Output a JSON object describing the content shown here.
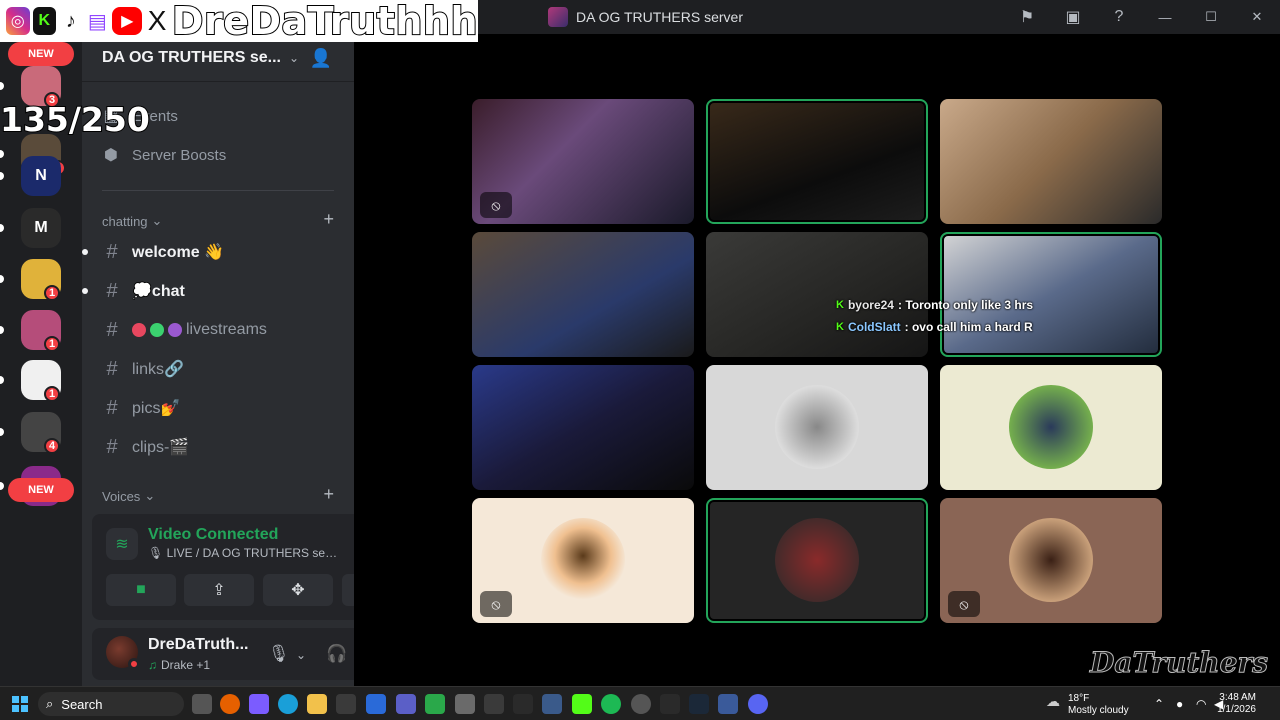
{
  "social_overlay": {
    "icons": [
      "instagram-icon",
      "kick-icon",
      "tiktok-icon",
      "twitch-icon",
      "youtube-icon",
      "x-icon"
    ],
    "handle": "DreDaTruthhh",
    "counter": "135/250"
  },
  "titlebar": {
    "title": "DA OG TRUTHERS server",
    "buttons": [
      "flag-icon",
      "inbox-icon",
      "help-icon",
      "minimize-icon",
      "maximize-icon",
      "close-icon"
    ]
  },
  "server_rail": {
    "new_top": "NEW",
    "new_bottom": "NEW",
    "servers": [
      {
        "name": "server-1",
        "badge": "3",
        "color": "#c96a7a"
      },
      {
        "name": "server-2",
        "badge": "20",
        "color": "#5a4b3a"
      },
      {
        "name": "server-3",
        "badge": "",
        "color": "#1b2a6b",
        "letter": "N"
      },
      {
        "name": "server-4",
        "badge": "",
        "color": "#2a2a2a",
        "letter": "M"
      },
      {
        "name": "server-5",
        "badge": "1",
        "color": "#e0b23a"
      },
      {
        "name": "server-6",
        "badge": "1",
        "color": "#b54d7a"
      },
      {
        "name": "server-7",
        "badge": "1",
        "color": "#f0f0f0"
      },
      {
        "name": "server-8",
        "badge": "4",
        "color": "#444"
      },
      {
        "name": "server-9",
        "badge": "",
        "color": "#8a2a8a"
      }
    ]
  },
  "sidebar": {
    "server_name": "DA OG TRUTHERS se...",
    "events_label": "Events",
    "boosts_label": "Server Boosts",
    "chatting_label": "chatting",
    "voices_label": "Voices",
    "channels": [
      {
        "name": "welcome 👋",
        "unread": true
      },
      {
        "name": "💭chat",
        "unread": true
      },
      {
        "name": "livestreams",
        "unread": false,
        "dots": [
          "#e8475f",
          "#3bd16f",
          "#9b59d0"
        ]
      },
      {
        "name": "links🔗",
        "unread": false
      },
      {
        "name": "pics💅",
        "unread": false
      },
      {
        "name": "clips-🎬",
        "unread": false
      }
    ]
  },
  "voice_panel": {
    "title": "Video Connected",
    "subtitle": "🎙 LIVE / DA OG TRUTHERS ser...",
    "buttons": [
      "camera-button",
      "screenshare-button",
      "activities-button",
      "soundboard-button"
    ]
  },
  "user_panel": {
    "name": "DreDaTruth...",
    "status": "Drake +1"
  },
  "stage": {
    "tiles": [
      {
        "name": "participant-1",
        "bg": "linear-gradient(135deg,#3a1d2a,#6a4a7a 40%,#1a1a2a)",
        "speaking": false,
        "muted": true
      },
      {
        "name": "participant-2",
        "bg": "linear-gradient(160deg,#3a2a1a,#0c0c0c 60%,#1e1e1e)",
        "speaking": true,
        "muted": false
      },
      {
        "name": "participant-3",
        "bg": "linear-gradient(135deg,#c9a98a,#8a6a4a 50%,#2a2a2a)",
        "speaking": false,
        "muted": false
      },
      {
        "name": "participant-4",
        "bg": "linear-gradient(150deg,#5a4a3a,#2a3a6a 60%,#1a1a1a)",
        "speaking": false,
        "muted": false
      },
      {
        "name": "participant-5",
        "bg": "linear-gradient(150deg,#3a3a38,#252523 60%,#151515)",
        "speaking": false,
        "muted": false
      },
      {
        "name": "participant-6",
        "bg": "linear-gradient(150deg,#d8d8d8,#5a6a8a 50%,#202a3a)",
        "speaking": true,
        "muted": false
      },
      {
        "name": "participant-7",
        "bg": "linear-gradient(150deg,#2a3a8a,#1a1a3a 50%,#0a0a0a)",
        "speaking": false,
        "muted": false
      },
      {
        "name": "participant-8",
        "bg": "#d8d8d8",
        "speaking": false,
        "muted": false,
        "avatar": "radial-gradient(circle,#888 0,#ddd 70%)"
      },
      {
        "name": "participant-9",
        "bg": "#ecead2",
        "speaking": false,
        "muted": false,
        "avatar": "radial-gradient(circle,#2a3a5a 0,#8ad04a 90%)"
      },
      {
        "name": "participant-10",
        "bg": "#f5e8d8",
        "speaking": false,
        "muted": true,
        "avatar": "radial-gradient(circle at 50% 45%,#5a3a1a 0,#f0c090 45%,#f5e8d8 70%)"
      },
      {
        "name": "participant-11",
        "bg": "#252525",
        "speaking": true,
        "muted": false,
        "avatar": "radial-gradient(circle,#8a2a2a 0,#3a2a2a 80%)"
      },
      {
        "name": "participant-12",
        "bg": "#8a6555",
        "speaking": false,
        "muted": true,
        "avatar": "radial-gradient(circle,#3a2015 0,#c9a07a 70%)"
      }
    ],
    "chat": [
      {
        "user": "byore24",
        "msg": ": Toronto only like 3 hrs"
      },
      {
        "user": "ColdSlatt",
        "msg": ": ovo call him a hard R"
      }
    ],
    "watermark": "DaTruthers"
  },
  "taskbar": {
    "search_label": "Search",
    "weather_temp": "18°F",
    "weather_desc": "Mostly cloudy",
    "time": "3:48 AM",
    "date": "1/1/2026"
  }
}
